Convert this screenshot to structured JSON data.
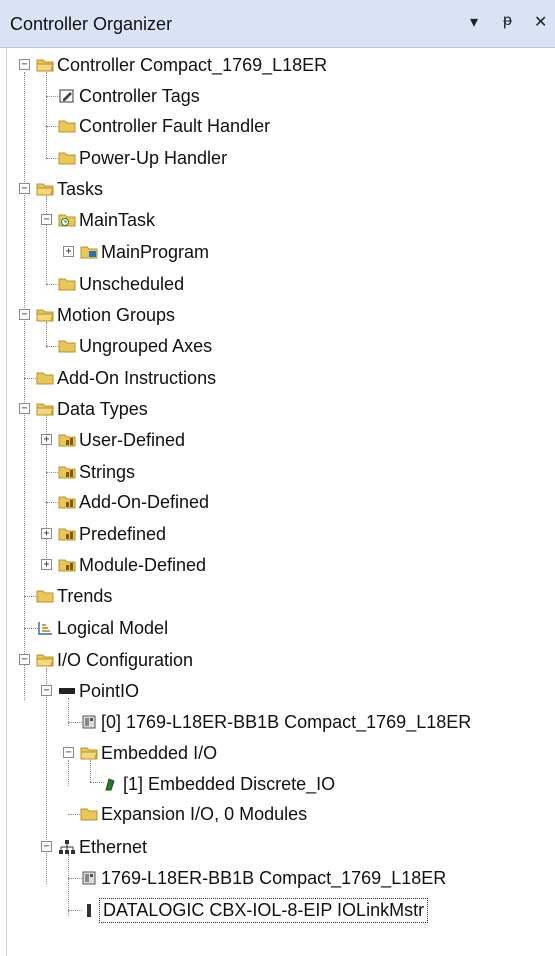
{
  "panel": {
    "title": "Controller Organizer",
    "btn_dropdown": "▾",
    "btn_pin": "ᵽ",
    "btn_close": "✕"
  },
  "tree": {
    "controller": "Controller Compact_1769_L18ER",
    "controller_tags": "Controller Tags",
    "controller_fault_handler": "Controller Fault Handler",
    "powerup_handler": "Power-Up Handler",
    "tasks": "Tasks",
    "maintask": "MainTask",
    "mainprogram": "MainProgram",
    "unscheduled": "Unscheduled",
    "motion_groups": "Motion Groups",
    "ungrouped_axes": "Ungrouped Axes",
    "addon_instructions": "Add-On Instructions",
    "data_types": "Data Types",
    "user_defined": "User-Defined",
    "strings": "Strings",
    "addon_defined": "Add-On-Defined",
    "predefined": "Predefined",
    "module_defined": "Module-Defined",
    "trends": "Trends",
    "logical_model": "Logical Model",
    "io_configuration": "I/O Configuration",
    "pointio": "PointIO",
    "pointio_0": "[0] 1769-L18ER-BB1B Compact_1769_L18ER",
    "embedded_io": "Embedded I/O",
    "embedded_discrete": "[1] Embedded Discrete_IO",
    "expansion_io": "Expansion I/O, 0 Modules",
    "ethernet": "Ethernet",
    "eth_controller": "1769-L18ER-BB1B Compact_1769_L18ER",
    "eth_datalogic": "DATALOGIC CBX-IOL-8-EIP IOLinkMstr"
  },
  "expanders": {
    "minus": "−",
    "plus": "+"
  },
  "colors": {
    "folder": "#e8c65a",
    "folder_dark": "#b8922a",
    "title_bg": "#d8e3f3"
  }
}
